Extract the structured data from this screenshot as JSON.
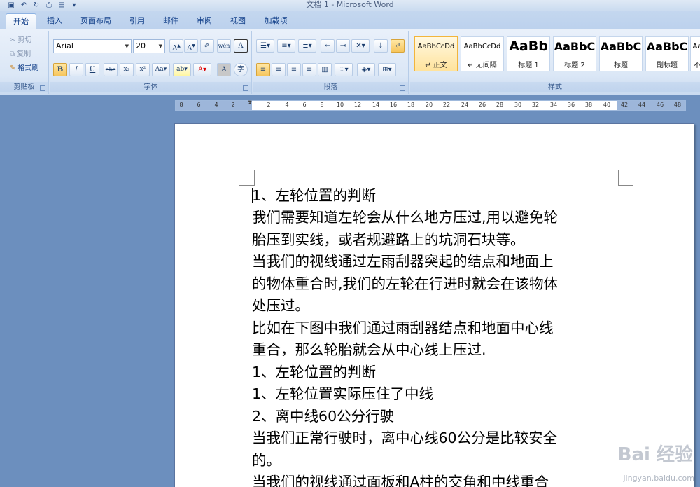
{
  "window": {
    "title": "文档 1 - Microsoft Word"
  },
  "tabs": [
    "开始",
    "插入",
    "页面布局",
    "引用",
    "邮件",
    "审阅",
    "视图",
    "加载项"
  ],
  "clipboard": {
    "cut": "剪切",
    "copy": "复制",
    "format_painter": "格式刷",
    "label": "剪贴板"
  },
  "font": {
    "name": "Arial",
    "size": "20",
    "label": "字体"
  },
  "paragraph": {
    "label": "段落"
  },
  "styles": {
    "label": "样式",
    "items": [
      {
        "sample": "AaBbCcDd",
        "name": "↵ 正文"
      },
      {
        "sample": "AaBbCcDd",
        "name": "↵ 无间隔"
      },
      {
        "sample": "AaBb",
        "name": "标题 1"
      },
      {
        "sample": "AaBbC",
        "name": "标题 2"
      },
      {
        "sample": "AaBbC",
        "name": "标题"
      },
      {
        "sample": "AaBbC",
        "name": "副标题"
      },
      {
        "sample": "Aa",
        "name": "不"
      }
    ]
  },
  "ruler": {
    "numbers": [
      "8",
      "6",
      "4",
      "2",
      "2",
      "4",
      "6",
      "8",
      "10",
      "12",
      "14",
      "16",
      "18",
      "20",
      "22",
      "24",
      "26",
      "28",
      "30",
      "32",
      "34",
      "36",
      "38",
      "40",
      "42",
      "44",
      "46",
      "48"
    ]
  },
  "document": {
    "lines": [
      "1、左轮位置的判断",
      "我们需要知道左轮会从什么地方压过,用以避免轮",
      "胎压到实线，或者规避路上的坑洞石块等。",
      "当我们的视线通过左雨刮器突起的结点和地面上",
      "的物体重合时,我们的左轮在行进时就会在该物体",
      "处压过。",
      "比如在下图中我们通过雨刮器结点和地面中心线",
      "重合，那么轮胎就会从中心线上压过.",
      "1、左轮位置的判断",
      "1、左轮位置实际压住了中线",
      "2、离中线60公分行驶",
      "当我们正常行驶时，离中心线60公分是比较安全",
      "的。",
      "当我们的视线通过面板和A柱的交角和中线重合"
    ]
  },
  "watermark": {
    "brand": "Bai 经验",
    "url": "jingyan.baidu.com"
  }
}
